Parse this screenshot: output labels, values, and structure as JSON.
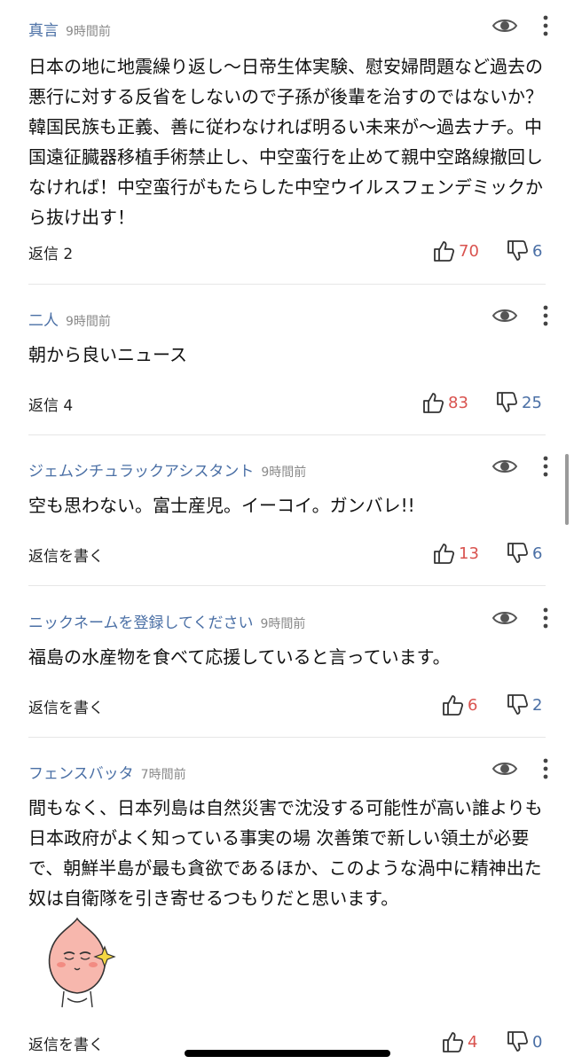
{
  "comments": [
    {
      "name": "真言",
      "time": "9時間前",
      "text": "日本の地に地震繰り返し～日帝生体実験、慰安婦問題など過去の悪行に対する反省をしないので子孫が後輩を治すのではないか？韓国民族も正義、善に従わなければ明るい未来が～過去ナチ。中国遠征臓器移植手術禁止し、中空蛮行を止めて親中空路線撤回しなければ！中空蛮行がもたらした中空ウイルスフェンデミックから抜け出す！",
      "reply": "返信 2",
      "likes": "70",
      "dislikes": "6"
    },
    {
      "name": "二人",
      "time": "9時間前",
      "text": "朝から良いニュース",
      "reply": "返信 4",
      "likes": "83",
      "dislikes": "25"
    },
    {
      "name": "ジェムシチュラックアシスタント",
      "time": "9時間前",
      "text": "空も思わない。富士産児。イーコイ。ガンバレ!!",
      "reply": "返信を書く",
      "likes": "13",
      "dislikes": "6"
    },
    {
      "name": "ニックネームを登録してください",
      "time": "9時間前",
      "text": "福島の水産物を食べて応援していると言っています。",
      "reply": "返信を書く",
      "likes": "6",
      "dislikes": "2"
    },
    {
      "name": "フェンスバッタ",
      "time": "7時間前",
      "text": "間もなく、日本列島は自然災害で沈没する可能性が高い誰よりも日本政府がよく知っている事実の場 次善策で新しい領土が必要で、朝鮮半島が最も貪欲であるほか、このような渦中に精神出た奴は自衛隊を引き寄せるつもりだと思います。",
      "reply": "返信を書く",
      "likes": "4",
      "dislikes": "0"
    }
  ]
}
